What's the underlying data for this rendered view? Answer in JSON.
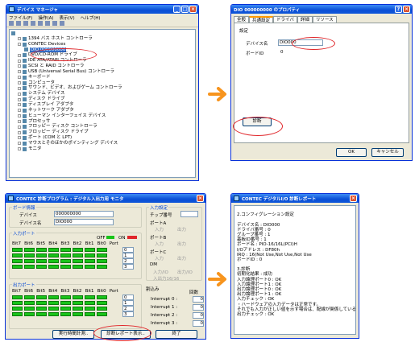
{
  "devmgr": {
    "title": "デバイス マネージャ",
    "menu": [
      "ファイル(F)",
      "操作(A)",
      "表示(V)",
      "ヘルプ(H)"
    ],
    "tree": [
      {
        "label": "",
        "level": 0
      },
      {
        "label": "1394 バス ホスト コントローラ",
        "level": 1
      },
      {
        "label": "CONTEC Devices",
        "level": 1
      },
      {
        "label": "DIO 000000000",
        "level": 2,
        "selected": true
      },
      {
        "label": "DVD/CD-ROM ドライブ",
        "level": 1
      },
      {
        "label": "IDE ATA/ATAPI コントローラ",
        "level": 1
      },
      {
        "label": "SCSI と RAID コントローラ",
        "level": 1
      },
      {
        "label": "USB (Universal Serial Bus) コントローラ",
        "level": 1
      },
      {
        "label": "キーボード",
        "level": 1
      },
      {
        "label": "コンピュータ",
        "level": 1
      },
      {
        "label": "サウンド、ビデオ、およびゲーム コントローラ",
        "level": 1
      },
      {
        "label": "システム デバイス",
        "level": 1
      },
      {
        "label": "ディスク ドライブ",
        "level": 1
      },
      {
        "label": "ディスプレイ アダプタ",
        "level": 1
      },
      {
        "label": "ネットワーク アダプタ",
        "level": 1
      },
      {
        "label": "ヒューマン インターフェイス デバイス",
        "level": 1
      },
      {
        "label": "プロセッサ",
        "level": 1
      },
      {
        "label": "フロッピー ディスク コントローラ",
        "level": 1
      },
      {
        "label": "フロッピー ディスク ドライブ",
        "level": 1
      },
      {
        "label": "ポート (COM と LPT)",
        "level": 1
      },
      {
        "label": "マウスとそのほかのポインティング デバイス",
        "level": 1
      },
      {
        "label": "モニタ",
        "level": 1
      }
    ]
  },
  "props": {
    "title": "DIO  000000000         のプロパティ",
    "tabs": [
      "全般",
      "共通設定",
      "ドライバ",
      "詳細",
      "リソース"
    ],
    "group": "設定",
    "device_name_label": "デバイス名",
    "device_name_value": "DIO000",
    "board_id_label": "ボードID",
    "board_id_value": "0",
    "diag_button": "診断",
    "ok": "OK",
    "cancel": "キャンセル"
  },
  "diag": {
    "title": "CONTEC 診断プログラム : デジタル入出力用 モニタ",
    "board_info": "ボード情報",
    "device_label": "デバイス",
    "device_value": "000000000",
    "devname_label": "デバイス名",
    "devname_value": "DIO000",
    "in_port": "入力ポート",
    "out_port": "出力ポート",
    "bits": [
      "Bit7",
      "Bit6",
      "Bit5",
      "Bit4",
      "Bit3",
      "Bit2",
      "Bit1",
      "Bit0",
      "Port"
    ],
    "off": "OFF",
    "on": "ON",
    "port_values": [
      "0",
      "1",
      "2",
      "3"
    ],
    "in_setting": "入力設定",
    "chip_no": "チップ番号",
    "port_a": "ポートA",
    "port_b": "ポートB",
    "port_c": "ポートC",
    "dm": "DM",
    "in": "入力",
    "out": "出力",
    "c1": "入力/IO",
    "c2": "出力/IO",
    "c3": "入出力16/16",
    "interrupt": "割込み",
    "count": "回数",
    "ints": [
      "Interrupt 0 :",
      "Interrupt 1 :",
      "Interrupt 2 :",
      "Interrupt 3 :"
    ],
    "int_values": [
      "0",
      "0",
      "0",
      "0"
    ],
    "btn_measure": "実行時間計測..",
    "btn_report": "診断レポート表示..",
    "btn_end": "終了"
  },
  "report": {
    "title": "CONTEC デジタルI/O 診断レポート",
    "lines": [
      "",
      "2.コンフィグレーション設定",
      "",
      "デバイス名 : DIO000",
      "ドライバ番号 : 0",
      "グループ番号 : 1",
      "基板ID番号 : 1",
      "ボード名 : PIO-16/16L(PCI)H",
      "I/Oアドレス : DF80h",
      "IRQ : 16(Not Use,Not Use,Not Use",
      "ボードID : 0",
      "",
      "3.診断",
      "初期化結果 : 成功",
      "入力論理ポート0 : OK",
      "入力論理ポート1 : OK",
      "出力論理ポート0 : OK",
      "出力論理ポート1 : OK",
      "入力チェック : OK",
      "・ハードウェアの入力データは正常です。",
      "それでも入力が正しい値を示す場合は、配線が関係している可",
      "出力チェック : OK"
    ]
  }
}
